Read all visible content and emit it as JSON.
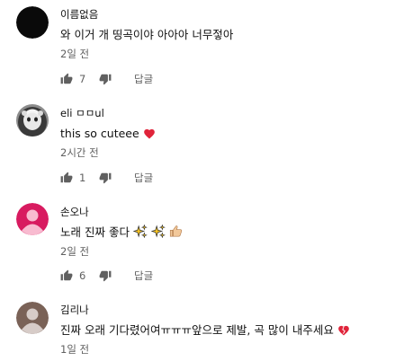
{
  "comments": [
    {
      "author": "이름없음",
      "text": "와 이거 개 띵곡이야 아아아 너무젛아",
      "time": "2일 전",
      "likes": "7",
      "reply_label": "답글"
    },
    {
      "author": "eli ㅁㅁul",
      "text": "this so cuteee",
      "time": "2시간 전",
      "likes": "1",
      "reply_label": "답글"
    },
    {
      "author": "손오나",
      "text": "노래 진짜 좋다",
      "time": "2일 전",
      "likes": "6",
      "reply_label": "답글"
    },
    {
      "author": "김리나",
      "text": "진짜 오래 기다렸어여ㅠㅠㅠ앞으로 제발, 곡 많이 내주세요",
      "time": "1일 전"
    }
  ],
  "colors": {
    "avatar_pink": "#d81b60",
    "avatar_brown": "#7a6257",
    "avatar_black": "#0a0a0a",
    "muted_text": "#606060",
    "heart": "#e0243a"
  },
  "icons": [
    "thumbs-up-icon",
    "thumbs-down-icon",
    "red-heart-emoji",
    "sparkles-emoji",
    "thumbs-up-emoji",
    "broken-heart-emoji"
  ]
}
